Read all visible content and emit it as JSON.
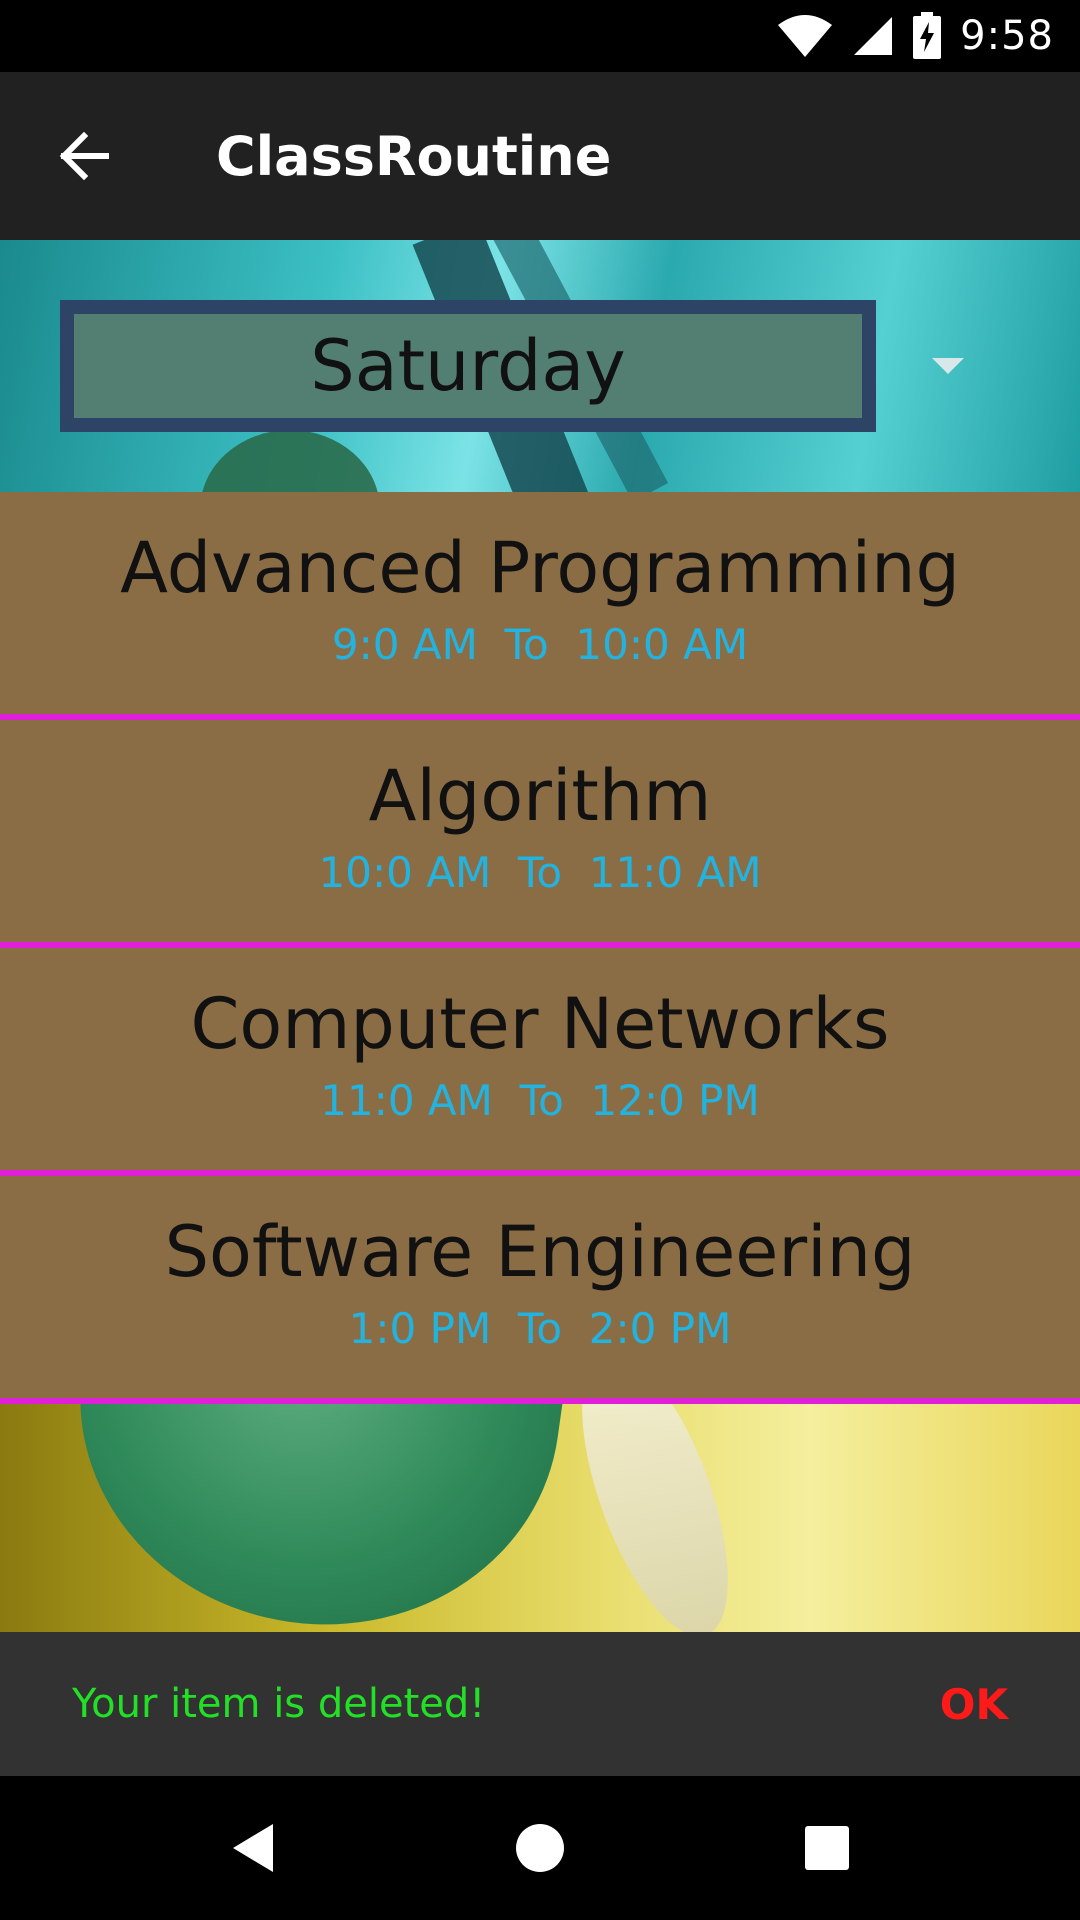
{
  "status_bar": {
    "time": "9:58"
  },
  "app_bar": {
    "title": "ClassRoutine"
  },
  "day_spinner": {
    "selected": "Saturday"
  },
  "routine": [
    {
      "course": "Advanced Programming",
      "time": "9:0 AM  To  10:0 AM"
    },
    {
      "course": "Algorithm",
      "time": "10:0 AM  To  11:0 AM"
    },
    {
      "course": "Computer Networks",
      "time": "11:0 AM  To  12:0 PM"
    },
    {
      "course": "Software Engineering",
      "time": "1:0 PM  To  2:0 PM"
    }
  ],
  "snackbar": {
    "message": "Your item is deleted!",
    "action": "OK"
  },
  "colors": {
    "row_bg": "#8b6d45",
    "divider": "#e01fd8",
    "time_text": "#22b3e0",
    "snack_message": "#22e025",
    "snack_action": "#ff1a1a"
  },
  "icons": {
    "back": "arrow-back-icon",
    "wifi": "wifi-icon",
    "signal": "cell-signal-icon",
    "battery": "battery-charging-icon",
    "nav_back": "triangle-back-icon",
    "nav_home": "circle-home-icon",
    "nav_recents": "square-recents-icon"
  }
}
